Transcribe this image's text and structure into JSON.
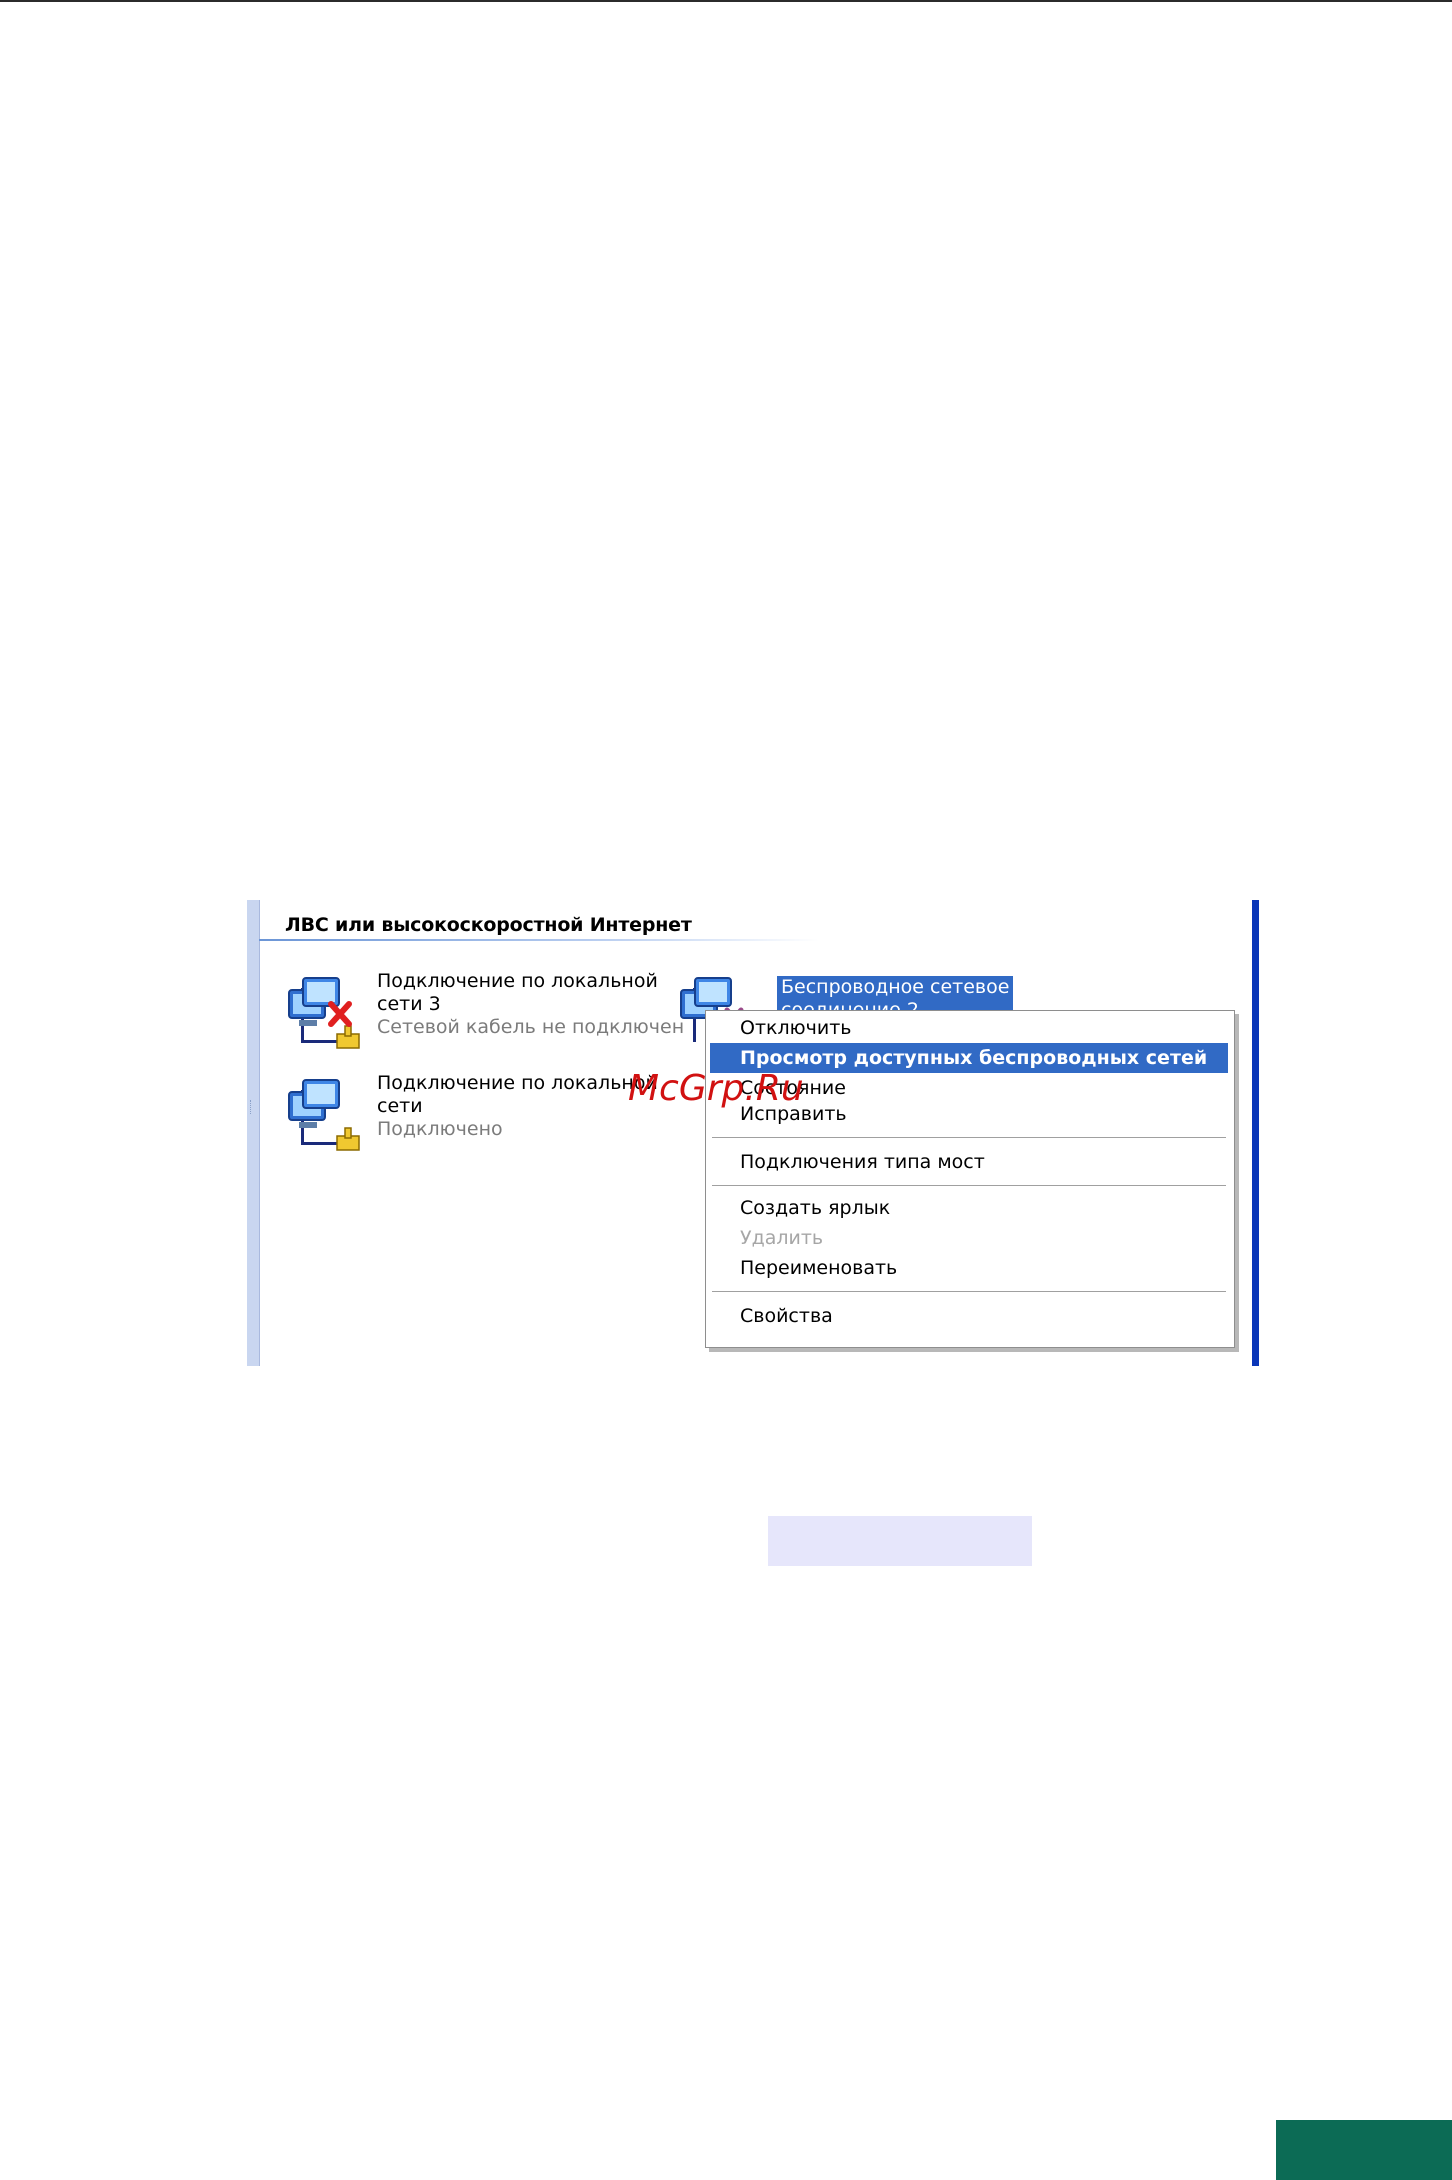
{
  "section_title": "ЛВС или высокоскоростной Интернет",
  "connections": [
    {
      "name_line1": "Подключение по локальной",
      "name_line2": "сети 3",
      "status": "Сетевой кабель не подключен",
      "state_icon": "red-x-icon"
    },
    {
      "name_line1": "Подключение по локальной",
      "name_line2": "сети",
      "status": "Подключено",
      "state_icon": "none"
    }
  ],
  "wireless_connection": {
    "name_line1": "Беспроводное сетевое",
    "name_line2": "соединение 2"
  },
  "context_menu": {
    "items": [
      {
        "label": "Отключить",
        "state": "normal"
      },
      {
        "label": "Просмотр доступных беспроводных сетей",
        "state": "selected"
      },
      {
        "label": "Состояние",
        "state": "normal"
      },
      {
        "label": "Исправить",
        "state": "normal"
      },
      {
        "label": "Подключения типа мост",
        "state": "normal"
      },
      {
        "label": "Создать ярлык",
        "state": "normal"
      },
      {
        "label": "Удалить",
        "state": "disabled"
      },
      {
        "label": "Переименовать",
        "state": "normal"
      },
      {
        "label": "Свойства",
        "state": "normal"
      }
    ]
  },
  "watermark": "McGrp.Ru",
  "colors": {
    "selection": "#316ac5",
    "frame_right_bar": "#0a36b8",
    "page_badge": "#0c6b55",
    "error_x": "#e02020"
  }
}
